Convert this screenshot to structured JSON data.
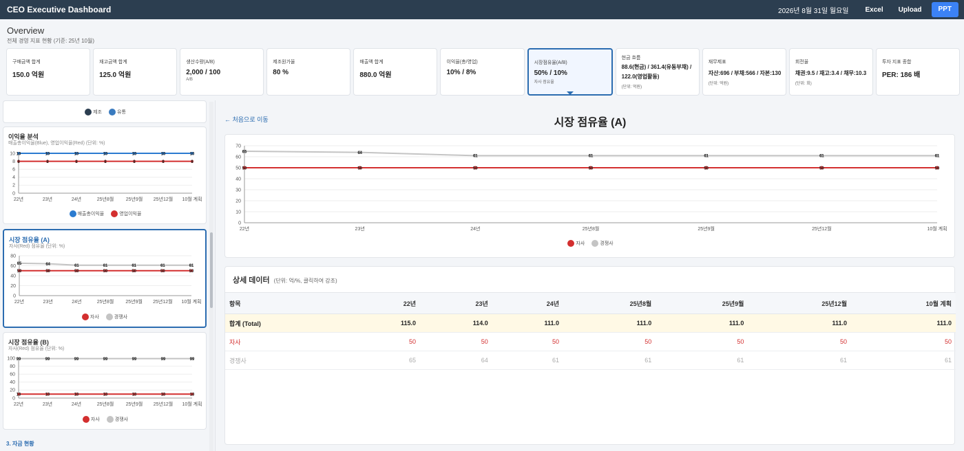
{
  "header": {
    "title": "CEO Executive Dashboard",
    "date": "2026년 8월 31일 월요일",
    "buttons": [
      "Excel",
      "Upload",
      "PPT"
    ]
  },
  "overview": {
    "title": "Overview",
    "subtitle": "전체 경영 지표 현황 (기준: 25년 10월)"
  },
  "kpis": [
    {
      "label": "구매금액 합계",
      "value": "150.0 억원",
      "unit": ""
    },
    {
      "label": "재고금액 합계",
      "value": "125.0 억원",
      "unit": ""
    },
    {
      "label": "생산수량(A/B)",
      "value": "2,000 / 100",
      "unit": "A/B"
    },
    {
      "label": "제조원가율",
      "value": "80 %",
      "unit": ""
    },
    {
      "label": "매출액 합계",
      "value": "880.0 억원",
      "unit": ""
    },
    {
      "label": "이익율(총/영업)",
      "value": "10% / 8%",
      "unit": ""
    },
    {
      "label": "시장점유율(A/B)",
      "value": "50% / 10%",
      "unit": "자사 점유율"
    },
    {
      "label": "현금 흐름",
      "value": "88.6(현금) / 361.4(유동부채) / 122.0(영업활동)",
      "unit": "(단위: 억원)"
    },
    {
      "label": "재무제표",
      "value": "자산:696 / 부채:566 / 자본:130",
      "unit": "(단위: 억원)"
    },
    {
      "label": "회전율",
      "value": "채권:9.5 / 재고:3.4 / 채무:10.3",
      "unit": "(단위: 회)"
    },
    {
      "label": "투자 지표 종합",
      "value": "PER: 186 배",
      "unit": ""
    }
  ],
  "left": {
    "top_legend": [
      "제조",
      "유통"
    ],
    "profit": {
      "title": "이익율 분석",
      "subtitle": "매출총이익율(Blue), 영업이익율(Red) (단위: %)",
      "legend": [
        "매출총이익율",
        "영업이익율"
      ]
    },
    "shareA": {
      "title": "시장 점유율 (A)",
      "subtitle": "자사(Red) 점유율 (단위: %)",
      "legend": [
        "자사",
        "경쟁사"
      ]
    },
    "shareB": {
      "title": "시장 점유율 (B)",
      "subtitle": "자사(Red) 점유율 (단위: %)",
      "legend": [
        "자사",
        "경쟁사"
      ]
    },
    "section3": "3. 자금 현황"
  },
  "main": {
    "back": "← 처음으로 이동",
    "title": "시장 점유율 (A)",
    "legend": [
      "자사",
      "경쟁사"
    ]
  },
  "detail": {
    "title": "상세 데이터",
    "note": "(단위: 억/%, 클릭하여 강조)",
    "columns": [
      "항목",
      "22년",
      "23년",
      "24년",
      "25년8월",
      "25년9월",
      "25년12월",
      "10월 계획"
    ],
    "rows": [
      {
        "label": "합계 (Total)",
        "values": [
          "115.0",
          "114.0",
          "111.0",
          "111.0",
          "111.0",
          "111.0",
          "111.0"
        ]
      },
      {
        "label": "자사",
        "values": [
          "50",
          "50",
          "50",
          "50",
          "50",
          "50",
          "50"
        ]
      },
      {
        "label": "경쟁사",
        "values": [
          "65",
          "64",
          "61",
          "61",
          "61",
          "61",
          "61"
        ]
      }
    ]
  },
  "chart_data": [
    {
      "type": "line",
      "title": "시장 점유율 (A)",
      "categories": [
        "22년",
        "23년",
        "24년",
        "25년8월",
        "25년9월",
        "25년12월",
        "10월 계획"
      ],
      "ylim": [
        0,
        70
      ],
      "yticks": [
        0,
        10,
        20,
        30,
        40,
        50,
        60,
        70
      ],
      "series": [
        {
          "name": "자사",
          "color": "#d32f2f",
          "values": [
            50,
            50,
            50,
            50,
            50,
            50,
            50
          ]
        },
        {
          "name": "경쟁사",
          "color": "#c4c4c4",
          "values": [
            65,
            64,
            61,
            61,
            61,
            61,
            61
          ]
        }
      ]
    },
    {
      "type": "line",
      "title": "이익율 분석",
      "categories": [
        "22년",
        "23년",
        "24년",
        "25년8월",
        "25년9월",
        "25년12월",
        "10월 계획"
      ],
      "ylim": [
        0,
        10
      ],
      "yticks": [
        0,
        2,
        4,
        6,
        8,
        10
      ],
      "series": [
        {
          "name": "매출총이익율",
          "color": "#2b7bd0",
          "values": [
            10,
            10,
            10,
            10,
            10,
            10,
            10
          ]
        },
        {
          "name": "영업이익율",
          "color": "#d32f2f",
          "values": [
            8,
            8,
            8,
            8,
            8,
            8,
            8
          ]
        }
      ]
    },
    {
      "type": "line",
      "title": "시장 점유율 (A)",
      "categories": [
        "22년",
        "23년",
        "24년",
        "25년8월",
        "25년9월",
        "25년12월",
        "10월 계획"
      ],
      "ylim": [
        0,
        80
      ],
      "yticks": [
        0,
        20,
        40,
        60,
        80
      ],
      "series": [
        {
          "name": "자사",
          "color": "#d32f2f",
          "values": [
            50,
            50,
            50,
            50,
            50,
            50,
            50
          ]
        },
        {
          "name": "경쟁사",
          "color": "#c4c4c4",
          "values": [
            65,
            64,
            61,
            61,
            61,
            61,
            61
          ]
        }
      ]
    },
    {
      "type": "line",
      "title": "시장 점유율 (B)",
      "categories": [
        "22년",
        "23년",
        "24년",
        "25년8월",
        "25년9월",
        "25년12월",
        "10월 계획"
      ],
      "ylim": [
        0,
        100
      ],
      "yticks": [
        0,
        20,
        40,
        60,
        80,
        100
      ],
      "series": [
        {
          "name": "자사",
          "color": "#d32f2f",
          "values": [
            10,
            10,
            10,
            10,
            10,
            10,
            10
          ]
        },
        {
          "name": "경쟁사",
          "color": "#c4c4c4",
          "values": [
            99,
            99,
            99,
            99,
            99,
            99,
            99
          ]
        }
      ]
    }
  ],
  "colors": {
    "topbar": "#2c3e50",
    "accent": "#2b6cb0",
    "primary_button": "#3b82f6",
    "self": "#d32f2f",
    "competitor": "#c4c4c4",
    "blue_series": "#2b7bd0",
    "navy": "#2c3e50",
    "teal": "#3a7bbf"
  }
}
